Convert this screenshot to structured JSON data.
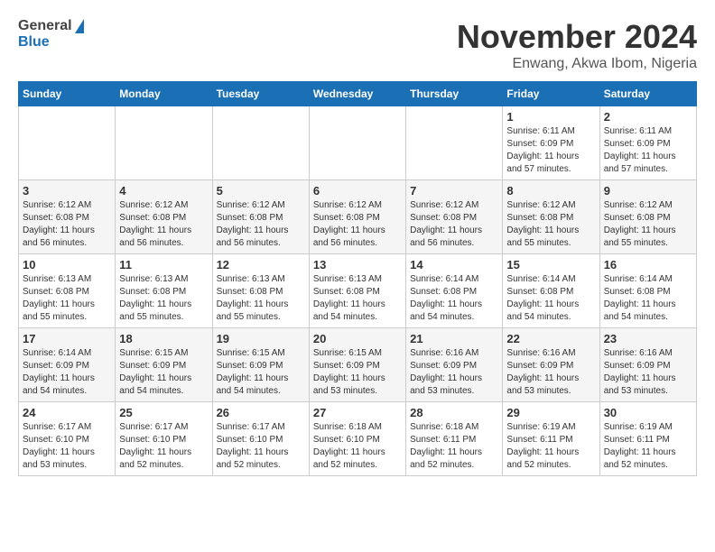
{
  "header": {
    "logo_general": "General",
    "logo_blue": "Blue",
    "month_title": "November 2024",
    "location": "Enwang, Akwa Ibom, Nigeria"
  },
  "weekdays": [
    "Sunday",
    "Monday",
    "Tuesday",
    "Wednesday",
    "Thursday",
    "Friday",
    "Saturday"
  ],
  "weeks": [
    [
      {
        "day": "",
        "info": ""
      },
      {
        "day": "",
        "info": ""
      },
      {
        "day": "",
        "info": ""
      },
      {
        "day": "",
        "info": ""
      },
      {
        "day": "",
        "info": ""
      },
      {
        "day": "1",
        "info": "Sunrise: 6:11 AM\nSunset: 6:09 PM\nDaylight: 11 hours and 57 minutes."
      },
      {
        "day": "2",
        "info": "Sunrise: 6:11 AM\nSunset: 6:09 PM\nDaylight: 11 hours and 57 minutes."
      }
    ],
    [
      {
        "day": "3",
        "info": "Sunrise: 6:12 AM\nSunset: 6:08 PM\nDaylight: 11 hours and 56 minutes."
      },
      {
        "day": "4",
        "info": "Sunrise: 6:12 AM\nSunset: 6:08 PM\nDaylight: 11 hours and 56 minutes."
      },
      {
        "day": "5",
        "info": "Sunrise: 6:12 AM\nSunset: 6:08 PM\nDaylight: 11 hours and 56 minutes."
      },
      {
        "day": "6",
        "info": "Sunrise: 6:12 AM\nSunset: 6:08 PM\nDaylight: 11 hours and 56 minutes."
      },
      {
        "day": "7",
        "info": "Sunrise: 6:12 AM\nSunset: 6:08 PM\nDaylight: 11 hours and 56 minutes."
      },
      {
        "day": "8",
        "info": "Sunrise: 6:12 AM\nSunset: 6:08 PM\nDaylight: 11 hours and 55 minutes."
      },
      {
        "day": "9",
        "info": "Sunrise: 6:12 AM\nSunset: 6:08 PM\nDaylight: 11 hours and 55 minutes."
      }
    ],
    [
      {
        "day": "10",
        "info": "Sunrise: 6:13 AM\nSunset: 6:08 PM\nDaylight: 11 hours and 55 minutes."
      },
      {
        "day": "11",
        "info": "Sunrise: 6:13 AM\nSunset: 6:08 PM\nDaylight: 11 hours and 55 minutes."
      },
      {
        "day": "12",
        "info": "Sunrise: 6:13 AM\nSunset: 6:08 PM\nDaylight: 11 hours and 55 minutes."
      },
      {
        "day": "13",
        "info": "Sunrise: 6:13 AM\nSunset: 6:08 PM\nDaylight: 11 hours and 54 minutes."
      },
      {
        "day": "14",
        "info": "Sunrise: 6:14 AM\nSunset: 6:08 PM\nDaylight: 11 hours and 54 minutes."
      },
      {
        "day": "15",
        "info": "Sunrise: 6:14 AM\nSunset: 6:08 PM\nDaylight: 11 hours and 54 minutes."
      },
      {
        "day": "16",
        "info": "Sunrise: 6:14 AM\nSunset: 6:08 PM\nDaylight: 11 hours and 54 minutes."
      }
    ],
    [
      {
        "day": "17",
        "info": "Sunrise: 6:14 AM\nSunset: 6:09 PM\nDaylight: 11 hours and 54 minutes."
      },
      {
        "day": "18",
        "info": "Sunrise: 6:15 AM\nSunset: 6:09 PM\nDaylight: 11 hours and 54 minutes."
      },
      {
        "day": "19",
        "info": "Sunrise: 6:15 AM\nSunset: 6:09 PM\nDaylight: 11 hours and 54 minutes."
      },
      {
        "day": "20",
        "info": "Sunrise: 6:15 AM\nSunset: 6:09 PM\nDaylight: 11 hours and 53 minutes."
      },
      {
        "day": "21",
        "info": "Sunrise: 6:16 AM\nSunset: 6:09 PM\nDaylight: 11 hours and 53 minutes."
      },
      {
        "day": "22",
        "info": "Sunrise: 6:16 AM\nSunset: 6:09 PM\nDaylight: 11 hours and 53 minutes."
      },
      {
        "day": "23",
        "info": "Sunrise: 6:16 AM\nSunset: 6:09 PM\nDaylight: 11 hours and 53 minutes."
      }
    ],
    [
      {
        "day": "24",
        "info": "Sunrise: 6:17 AM\nSunset: 6:10 PM\nDaylight: 11 hours and 53 minutes."
      },
      {
        "day": "25",
        "info": "Sunrise: 6:17 AM\nSunset: 6:10 PM\nDaylight: 11 hours and 52 minutes."
      },
      {
        "day": "26",
        "info": "Sunrise: 6:17 AM\nSunset: 6:10 PM\nDaylight: 11 hours and 52 minutes."
      },
      {
        "day": "27",
        "info": "Sunrise: 6:18 AM\nSunset: 6:10 PM\nDaylight: 11 hours and 52 minutes."
      },
      {
        "day": "28",
        "info": "Sunrise: 6:18 AM\nSunset: 6:11 PM\nDaylight: 11 hours and 52 minutes."
      },
      {
        "day": "29",
        "info": "Sunrise: 6:19 AM\nSunset: 6:11 PM\nDaylight: 11 hours and 52 minutes."
      },
      {
        "day": "30",
        "info": "Sunrise: 6:19 AM\nSunset: 6:11 PM\nDaylight: 11 hours and 52 minutes."
      }
    ]
  ]
}
